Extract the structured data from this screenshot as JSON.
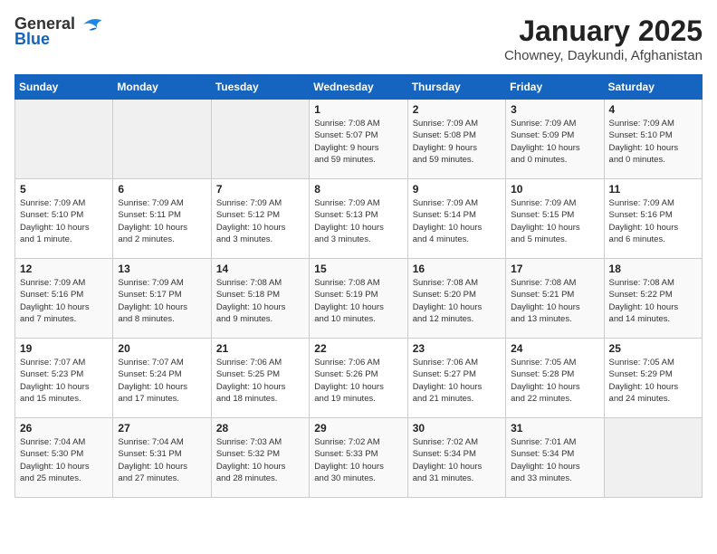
{
  "header": {
    "logo_general": "General",
    "logo_blue": "Blue",
    "month_title": "January 2025",
    "location": "Chowney, Daykundi, Afghanistan"
  },
  "days_of_week": [
    "Sunday",
    "Monday",
    "Tuesday",
    "Wednesday",
    "Thursday",
    "Friday",
    "Saturday"
  ],
  "weeks": [
    [
      {
        "day": "",
        "info": ""
      },
      {
        "day": "",
        "info": ""
      },
      {
        "day": "",
        "info": ""
      },
      {
        "day": "1",
        "info": "Sunrise: 7:08 AM\nSunset: 5:07 PM\nDaylight: 9 hours\nand 59 minutes."
      },
      {
        "day": "2",
        "info": "Sunrise: 7:09 AM\nSunset: 5:08 PM\nDaylight: 9 hours\nand 59 minutes."
      },
      {
        "day": "3",
        "info": "Sunrise: 7:09 AM\nSunset: 5:09 PM\nDaylight: 10 hours\nand 0 minutes."
      },
      {
        "day": "4",
        "info": "Sunrise: 7:09 AM\nSunset: 5:10 PM\nDaylight: 10 hours\nand 0 minutes."
      }
    ],
    [
      {
        "day": "5",
        "info": "Sunrise: 7:09 AM\nSunset: 5:10 PM\nDaylight: 10 hours\nand 1 minute."
      },
      {
        "day": "6",
        "info": "Sunrise: 7:09 AM\nSunset: 5:11 PM\nDaylight: 10 hours\nand 2 minutes."
      },
      {
        "day": "7",
        "info": "Sunrise: 7:09 AM\nSunset: 5:12 PM\nDaylight: 10 hours\nand 3 minutes."
      },
      {
        "day": "8",
        "info": "Sunrise: 7:09 AM\nSunset: 5:13 PM\nDaylight: 10 hours\nand 3 minutes."
      },
      {
        "day": "9",
        "info": "Sunrise: 7:09 AM\nSunset: 5:14 PM\nDaylight: 10 hours\nand 4 minutes."
      },
      {
        "day": "10",
        "info": "Sunrise: 7:09 AM\nSunset: 5:15 PM\nDaylight: 10 hours\nand 5 minutes."
      },
      {
        "day": "11",
        "info": "Sunrise: 7:09 AM\nSunset: 5:16 PM\nDaylight: 10 hours\nand 6 minutes."
      }
    ],
    [
      {
        "day": "12",
        "info": "Sunrise: 7:09 AM\nSunset: 5:16 PM\nDaylight: 10 hours\nand 7 minutes."
      },
      {
        "day": "13",
        "info": "Sunrise: 7:09 AM\nSunset: 5:17 PM\nDaylight: 10 hours\nand 8 minutes."
      },
      {
        "day": "14",
        "info": "Sunrise: 7:08 AM\nSunset: 5:18 PM\nDaylight: 10 hours\nand 9 minutes."
      },
      {
        "day": "15",
        "info": "Sunrise: 7:08 AM\nSunset: 5:19 PM\nDaylight: 10 hours\nand 10 minutes."
      },
      {
        "day": "16",
        "info": "Sunrise: 7:08 AM\nSunset: 5:20 PM\nDaylight: 10 hours\nand 12 minutes."
      },
      {
        "day": "17",
        "info": "Sunrise: 7:08 AM\nSunset: 5:21 PM\nDaylight: 10 hours\nand 13 minutes."
      },
      {
        "day": "18",
        "info": "Sunrise: 7:08 AM\nSunset: 5:22 PM\nDaylight: 10 hours\nand 14 minutes."
      }
    ],
    [
      {
        "day": "19",
        "info": "Sunrise: 7:07 AM\nSunset: 5:23 PM\nDaylight: 10 hours\nand 15 minutes."
      },
      {
        "day": "20",
        "info": "Sunrise: 7:07 AM\nSunset: 5:24 PM\nDaylight: 10 hours\nand 17 minutes."
      },
      {
        "day": "21",
        "info": "Sunrise: 7:06 AM\nSunset: 5:25 PM\nDaylight: 10 hours\nand 18 minutes."
      },
      {
        "day": "22",
        "info": "Sunrise: 7:06 AM\nSunset: 5:26 PM\nDaylight: 10 hours\nand 19 minutes."
      },
      {
        "day": "23",
        "info": "Sunrise: 7:06 AM\nSunset: 5:27 PM\nDaylight: 10 hours\nand 21 minutes."
      },
      {
        "day": "24",
        "info": "Sunrise: 7:05 AM\nSunset: 5:28 PM\nDaylight: 10 hours\nand 22 minutes."
      },
      {
        "day": "25",
        "info": "Sunrise: 7:05 AM\nSunset: 5:29 PM\nDaylight: 10 hours\nand 24 minutes."
      }
    ],
    [
      {
        "day": "26",
        "info": "Sunrise: 7:04 AM\nSunset: 5:30 PM\nDaylight: 10 hours\nand 25 minutes."
      },
      {
        "day": "27",
        "info": "Sunrise: 7:04 AM\nSunset: 5:31 PM\nDaylight: 10 hours\nand 27 minutes."
      },
      {
        "day": "28",
        "info": "Sunrise: 7:03 AM\nSunset: 5:32 PM\nDaylight: 10 hours\nand 28 minutes."
      },
      {
        "day": "29",
        "info": "Sunrise: 7:02 AM\nSunset: 5:33 PM\nDaylight: 10 hours\nand 30 minutes."
      },
      {
        "day": "30",
        "info": "Sunrise: 7:02 AM\nSunset: 5:34 PM\nDaylight: 10 hours\nand 31 minutes."
      },
      {
        "day": "31",
        "info": "Sunrise: 7:01 AM\nSunset: 5:34 PM\nDaylight: 10 hours\nand 33 minutes."
      },
      {
        "day": "",
        "info": ""
      }
    ]
  ]
}
